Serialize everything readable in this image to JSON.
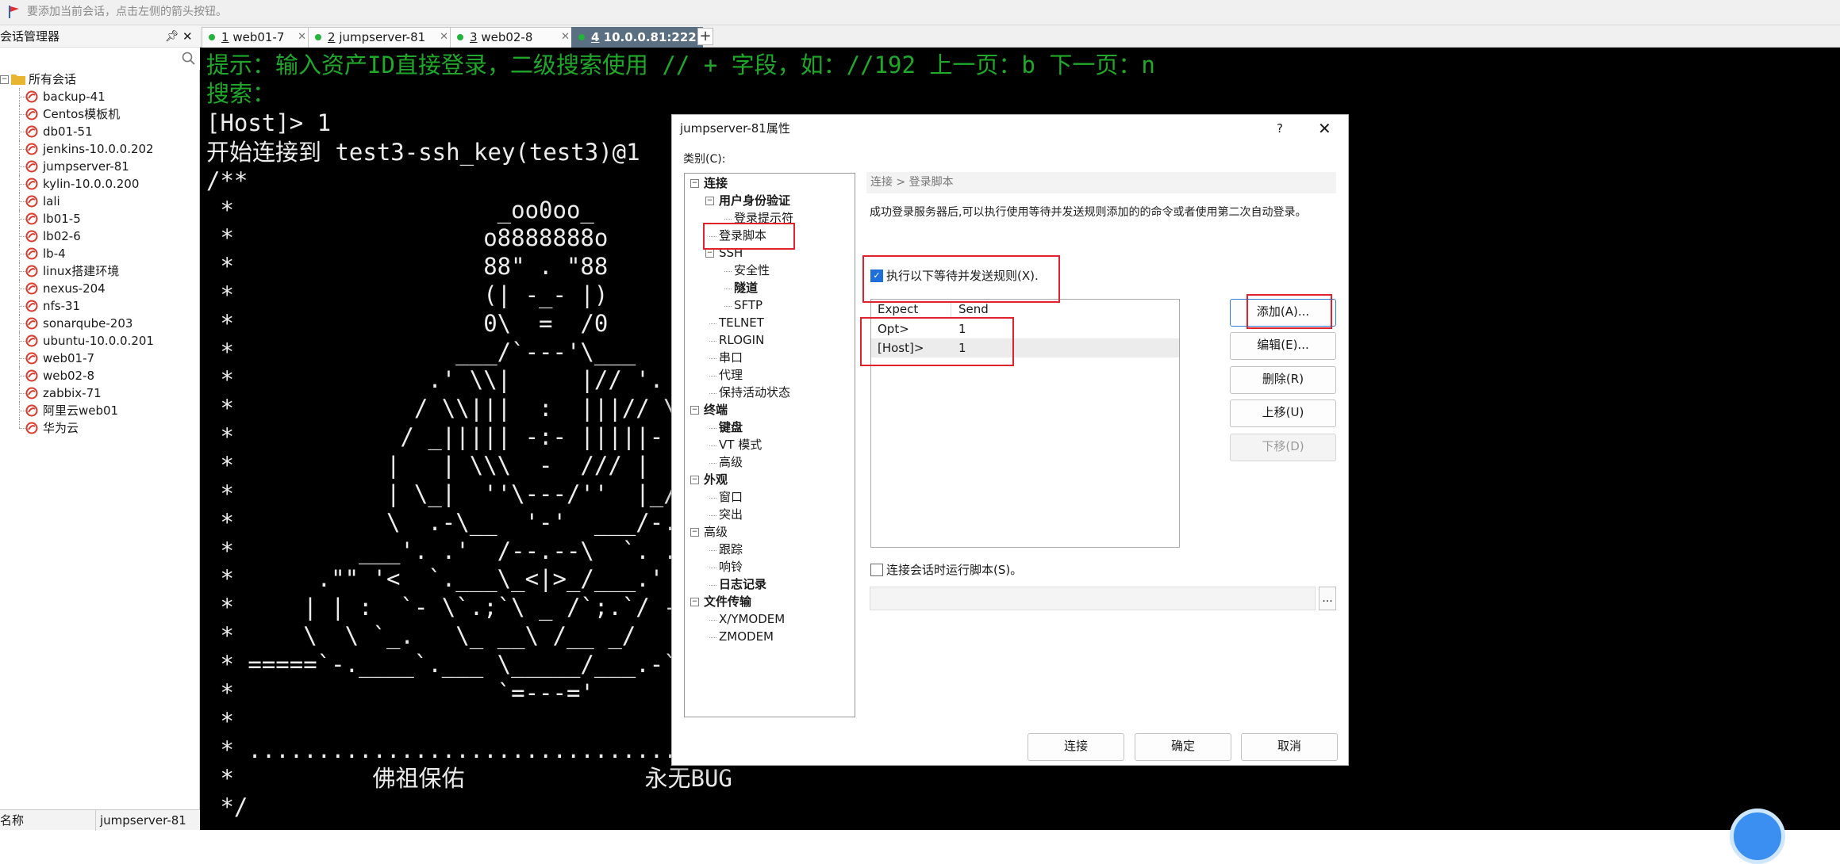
{
  "hint_bar": {
    "text": "要添加当前会话，点击左侧的箭头按钮。"
  },
  "session_manager": {
    "title": "会话管理器",
    "pin": "ᵖ",
    "close": "✕",
    "root_label": "所有会话",
    "sessions": [
      "backup-41",
      "Centos模板机",
      "db01-51",
      "jenkins-10.0.0.202",
      "jumpserver-81",
      "kylin-10.0.0.200",
      "lali",
      "lb01-5",
      "lb02-6",
      "lb-4",
      "linux搭建环境",
      "nexus-204",
      "nfs-31",
      "sonarqube-203",
      "ubuntu-10.0.0.201",
      "web01-7",
      "web02-8",
      "zabbix-71",
      "阿里云web01",
      "华为云"
    ],
    "footer_name_label": "名称",
    "footer_name_value": "jumpserver-81"
  },
  "tabs": [
    {
      "num": "1",
      "label": "web01-7",
      "close": "✕"
    },
    {
      "num": "2",
      "label": "jumpserver-81",
      "close": "✕"
    },
    {
      "num": "3",
      "label": "web02-8",
      "close": "✕"
    },
    {
      "num": "4",
      "label": "10.0.0.81:2222",
      "close": "✕"
    }
  ],
  "tab_add": "+",
  "terminal": {
    "lines": [
      "提示：输入资产ID直接登录，二级搜索使用 // + 字段，如：//192 上一页：b 下一页：n",
      "搜索：",
      "[Host]> 1",
      "开始连接到 test3-ssh_key(test3)@1",
      "/**",
      " *                   _oo0oo_",
      " *                  o8888888o",
      " *                  88\" . \"88",
      " *                  (| -_- |)",
      " *                  0\\  =  /0",
      " *                ___/`---'\\___",
      " *              .' \\\\|     |// '.",
      " *             / \\\\|||  :  |||// \\",
      " *            / _||||| -:- |||||- \\",
      " *           |   | \\\\\\  -  /// |   |",
      " *           | \\_|  ''\\---/''  |_/ |",
      " *           \\  .-\\__  '-'  ___/-. /",
      " *         ___'. .'  /--.--\\  `. .'___",
      " *      .\"\" '<  `.___\\_<|>_/___.' >' \"\".",
      " *     | | :  `- \\`.;`\\ _ /`;.`/ - ` : | |",
      " *     \\  \\ `_.   \\_ __\\ /__ _/   .-` /  /",
      " * =====`-.____`.___ \\_____/___.-`___.-'=====",
      " *                   `=---='",
      " *",
      " * ..........................................",
      " *          佛祖保佑             永无BUG",
      " */"
    ]
  },
  "dialog": {
    "title": "jumpserver-81属性",
    "help": "?",
    "close": "✕",
    "category_label": "类别(C):",
    "categories": [
      "连接",
      "用户身份验证",
      "登录提示符",
      "登录脚本",
      "SSH",
      "安全性",
      "隧道",
      "SFTP",
      "TELNET",
      "RLOGIN",
      "串口",
      "代理",
      "保持活动状态",
      "终端",
      "键盘",
      "VT 模式",
      "高级",
      "外观",
      "窗口",
      "突出",
      "高级",
      "跟踪",
      "响铃",
      "日志记录",
      "文件传输",
      "X/YMODEM",
      "ZMODEM"
    ],
    "breadcrumb": "连接 > 登录脚本",
    "description": "成功登录服务器后,可以执行使用等待并发送规则添加的的命令或者使用第二次自动登录。",
    "rules_checkbox_label": "执行以下等待并发送规则(X).",
    "rules_checkbox_checked": true,
    "check_mark": "✓",
    "columns": {
      "expect": "Expect",
      "send": "Send"
    },
    "rules": [
      {
        "expect": "Opt>",
        "send": "1"
      },
      {
        "expect": "[Host]>",
        "send": "1"
      }
    ],
    "side_buttons": {
      "add": "添加(A)...",
      "edit": "编辑(E)...",
      "delete": "删除(R)",
      "up": "上移(U)",
      "down": "下移(D)"
    },
    "run_script_label": "连接会话时运行脚本(S)。",
    "run_script_checked": false,
    "script_path": "",
    "browse": "...",
    "footer_buttons": {
      "connect": "连接",
      "ok": "确定",
      "cancel": "取消"
    },
    "accent_color": "#e0222e"
  }
}
